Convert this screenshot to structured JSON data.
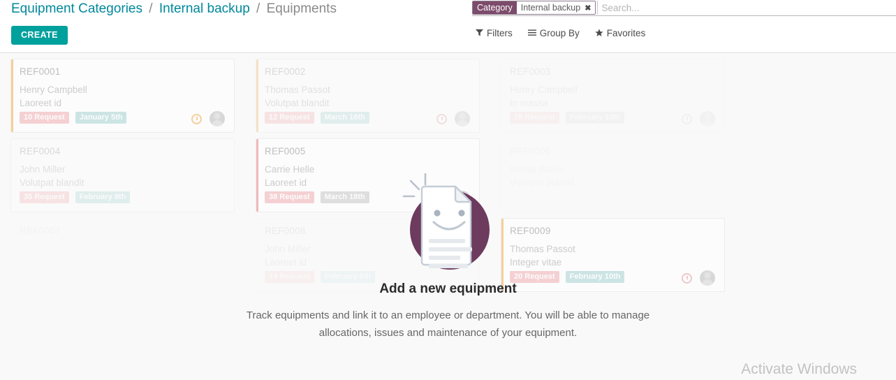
{
  "breadcrumb": {
    "root": "Equipment Categories",
    "parent": "Internal backup",
    "current": "Equipments",
    "separator": "/"
  },
  "toolbar": {
    "create_label": "CREATE"
  },
  "search": {
    "facet_label": "Category",
    "facet_value": "Internal backup",
    "facet_remove_icon": "✖",
    "placeholder": "Search..."
  },
  "filter_menus": [
    {
      "label": "Filters",
      "icon": "▼",
      "icon_name": "filter-funnel-icon"
    },
    {
      "label": "Group By",
      "icon": "☰",
      "icon_name": "hamburger-icon"
    },
    {
      "label": "Favorites",
      "icon": "★",
      "icon_name": "star-icon"
    }
  ],
  "cards": [
    {
      "ref": "REF0001",
      "person": "Henry Campbell",
      "model": "Laoreet id",
      "request_tag": "10 Request",
      "date_tag": "January 5th",
      "bar_color": "#f0ad4e",
      "bar_class": "bar-orange",
      "clock_class": "c-orange",
      "tag_request_class": "tag-red",
      "tag_date_class": "tag-teal",
      "fade": "fade-1",
      "has_meta": true
    },
    {
      "ref": "REF0002",
      "person": "Thomas Passot",
      "model": "Volutpat blandit",
      "request_tag": "12 Request",
      "date_tag": "March 16th",
      "bar_color": "#f0ad4e",
      "bar_class": "bar-orange",
      "clock_class": "c-red",
      "tag_request_class": "tag-red",
      "tag_date_class": "tag-teal",
      "fade": "fade-2",
      "has_meta": true
    },
    {
      "ref": "REF0003",
      "person": "Henry Campbell",
      "model": "In massa",
      "request_tag": "28 Request",
      "date_tag": "February 10th",
      "bar_color": "transparent",
      "bar_class": "bar-none",
      "clock_class": "c-grey",
      "tag_request_class": "tag-red",
      "tag_date_class": "tag-grey",
      "fade": "fade-3",
      "has_meta": true
    },
    {
      "ref": "REF0004",
      "person": "John Miller",
      "model": "Volutpat blandit",
      "request_tag": "35 Request",
      "date_tag": "February 8th",
      "bar_color": "transparent",
      "bar_class": "bar-none",
      "clock_class": "c-grey",
      "tag_request_class": "tag-red",
      "tag_date_class": "tag-teal",
      "fade": "fade-2",
      "has_meta": false
    },
    {
      "ref": "REF0005",
      "person": "Carrie Helle",
      "model": "Laoreet id",
      "request_tag": "38 Request",
      "date_tag": "March 18th",
      "bar_color": "#e8848c",
      "bar_class": "bar-red",
      "clock_class": "c-red",
      "tag_request_class": "tag-red",
      "tag_date_class": "tag-grey",
      "fade": "fade-1",
      "has_meta": true
    },
    {
      "ref": "REF0006",
      "person": "Wendi Baker",
      "model": "Volutpat blandit",
      "request_tag": "",
      "date_tag": "",
      "bar_color": "transparent",
      "bar_class": "bar-none",
      "clock_class": "c-grey",
      "tag_request_class": "tag-red",
      "tag_date_class": "tag-teal",
      "fade": "fade-4",
      "has_meta": false
    },
    {
      "ref": "REF0007",
      "person": "",
      "model": "",
      "request_tag": "",
      "date_tag": "",
      "bar_color": "transparent",
      "bar_class": "bar-none",
      "clock_class": "c-grey",
      "tag_request_class": "tag-red",
      "tag_date_class": "tag-teal",
      "fade": "fade-4",
      "has_meta": false
    },
    {
      "ref": "REF0008",
      "person": "John Miller",
      "model": "Laoreet id",
      "request_tag": "14 Request",
      "date_tag": "February 6th",
      "bar_color": "transparent",
      "bar_class": "bar-none",
      "clock_class": "c-grey",
      "tag_request_class": "tag-red",
      "tag_date_class": "tag-teal",
      "fade": "fade-3",
      "has_meta": false
    },
    {
      "ref": "REF0009",
      "person": "Thomas Passot",
      "model": "Integer vitae",
      "request_tag": "20 Request",
      "date_tag": "February 10th",
      "bar_color": "#f0ad4e",
      "bar_class": "bar-orange",
      "clock_class": "c-red",
      "tag_request_class": "tag-red",
      "tag_date_class": "tag-teal",
      "fade": "fade-1",
      "has_meta": true
    }
  ],
  "empty_state": {
    "title": "Add a new equipment",
    "description": "Track equipments and link it to an employee or department. You will be able to manage allocations, issues and maintenance of your equipment.",
    "art_name": "smiling-document-illustration",
    "art_circle_color": "#6d3b5e",
    "art_paper_color": "#ffffff"
  },
  "watermark": {
    "title": "Activate Windows"
  },
  "colors": {
    "accent_teal": "#00a09d",
    "link_teal": "#00889b",
    "facet_purple": "#7d4b6b",
    "bar_orange": "#f0ad4e",
    "bar_red": "#e8848c",
    "tag_red": "#f3b0b3",
    "tag_teal": "#a9d4d4",
    "page_bg": "#f9f9f9"
  }
}
